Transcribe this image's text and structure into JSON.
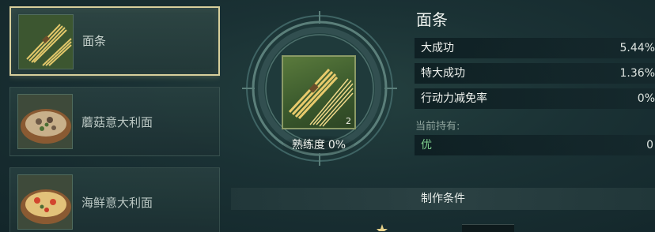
{
  "recipes": [
    {
      "name": "面条",
      "selected": true,
      "icon": "noodles-icon"
    },
    {
      "name": "蘑菇意大利面",
      "selected": false,
      "icon": "mushroom-pasta-icon"
    },
    {
      "name": "海鲜意大利面",
      "selected": false,
      "icon": "seafood-pasta-icon"
    }
  ],
  "item": {
    "title": "面条",
    "icon": "noodles-icon",
    "count": "2",
    "proficiency_label": "熟练度",
    "proficiency_value": "0%"
  },
  "stats": [
    {
      "label": "大成功",
      "value": "5.44%"
    },
    {
      "label": "特大成功",
      "value": "1.36%"
    },
    {
      "label": "行动力减免率",
      "value": "0%"
    }
  ],
  "held": {
    "label": "当前持有:",
    "quality": "优",
    "count": "0"
  },
  "conditions": {
    "label": "制作条件"
  },
  "colors": {
    "selected_border": "#d8cf9c",
    "quality_green": "#7fcf8e"
  }
}
